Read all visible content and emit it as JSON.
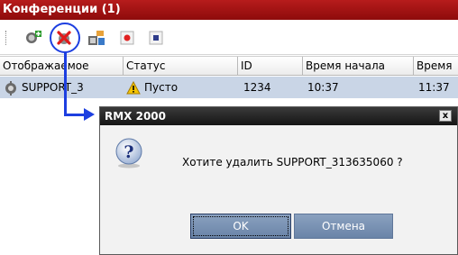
{
  "panel": {
    "title": "Конференции (1)"
  },
  "toolbar": {
    "buttons": [
      {
        "icon": "add-conference-icon"
      },
      {
        "icon": "delete-conference-icon"
      },
      {
        "icon": "template-icon"
      },
      {
        "icon": "record-icon"
      },
      {
        "icon": "stop-icon"
      }
    ]
  },
  "table": {
    "columns": [
      "Отображаемое",
      "Статус",
      "ID",
      "Время начала",
      "Время"
    ],
    "rows": [
      {
        "name": "SUPPORT_3",
        "status": "Пусто",
        "id": "1234",
        "start_time": "10:37",
        "end_time": "11:37"
      }
    ]
  },
  "dialog": {
    "title": "RMX 2000",
    "close_label": "x",
    "message": "Хотите удалить SUPPORT_313635060 ?",
    "ok_label": "OK",
    "cancel_label": "Отмена"
  },
  "colors": {
    "header_red": "#b71c1c",
    "highlight_blue": "#1d3fe0",
    "row_selected": "#c9d5e6",
    "dialog_button": "#7a92b3"
  }
}
